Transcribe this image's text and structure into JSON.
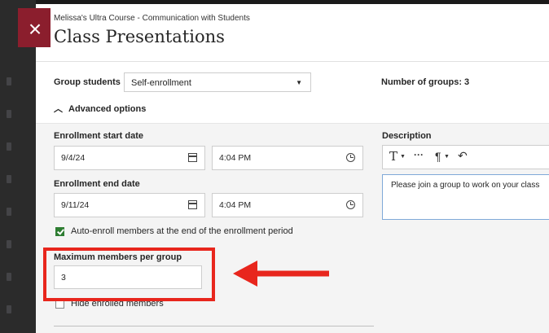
{
  "header": {
    "breadcrumb": "Melissa's Ultra Course - Communication with Students",
    "title": "Class Presentations"
  },
  "close_icon": "close-icon",
  "group_students": {
    "label": "Group students",
    "selected": "Self-enrollment",
    "number_of_groups": "Number of groups: 3"
  },
  "advanced": {
    "label": "Advanced options"
  },
  "enrollment_start": {
    "label": "Enrollment start date",
    "date": "9/4/24",
    "time": "4:04 PM"
  },
  "enrollment_end": {
    "label": "Enrollment end date",
    "date": "9/11/24",
    "time": "4:04 PM"
  },
  "auto_enroll": {
    "label": "Auto-enroll members at the end of the enrollment period",
    "checked": true
  },
  "max_members": {
    "label": "Maximum members per group",
    "value": "3"
  },
  "hide_enrolled": {
    "label": "Hide enrolled members",
    "checked": false
  },
  "description": {
    "label": "Description",
    "text": "Please join a group to work on your class"
  },
  "colors": {
    "accent_red": "#e8261d",
    "close_bg": "#8b1e2d",
    "check_green": "#2e7d32"
  }
}
